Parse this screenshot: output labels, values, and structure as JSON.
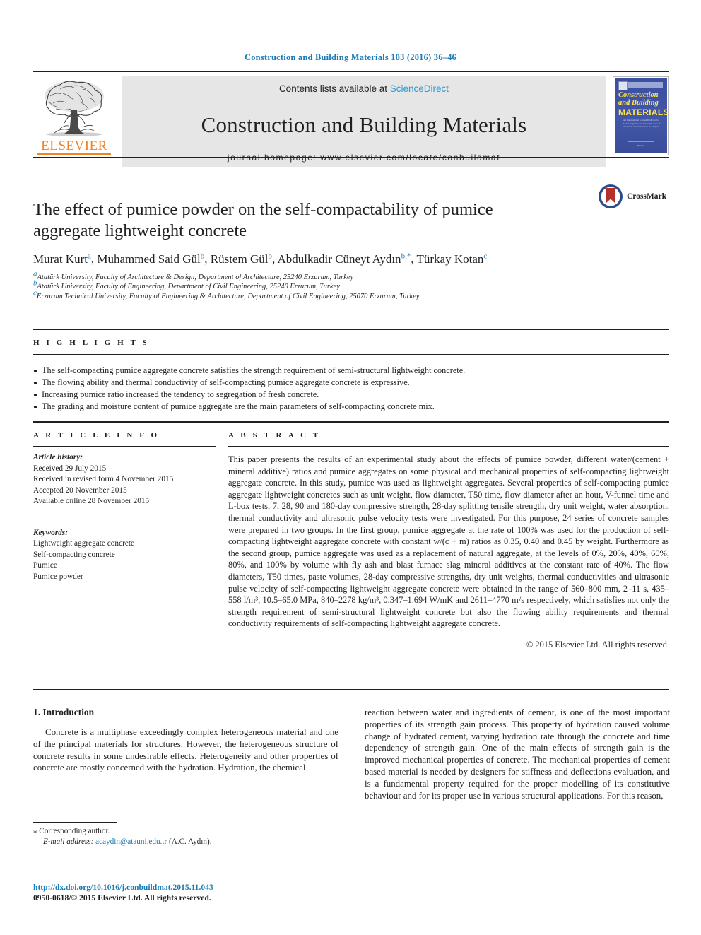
{
  "running_head": "Construction and Building Materials 103 (2016) 36–46",
  "masthead": {
    "publisher_name": "ELSEVIER",
    "contents_prefix": "Contents lists available at ",
    "contents_link": "ScienceDirect",
    "journal_name": "Construction and Building Materials",
    "homepage_line": "journal homepage: www.elsevier.com/locate/conbuildmat",
    "cover": {
      "line1": "Construction",
      "line2": "and Building",
      "line3": "MATERIALS",
      "blurb": "An International Journal Dedicated to the Investigation and Innovative Use of Materials in Construction and Repair",
      "footer": "Elsevier"
    }
  },
  "article": {
    "title": "The effect of pumice powder on the self-compactability of pumice aggregate lightweight concrete",
    "crossmark_label": "CrossMark",
    "authors": [
      {
        "name": "Murat Kurt",
        "sup": "a",
        "sep": ", "
      },
      {
        "name": "Muhammed Said Gül",
        "sup": "b",
        "sep": ", "
      },
      {
        "name": "Rüstem Gül",
        "sup": "b",
        "sep": ", "
      },
      {
        "name": "Abdulkadir Cüneyt Aydın",
        "sup": "b,*",
        "sep": ", "
      },
      {
        "name": "Türkay Kotan",
        "sup": "c",
        "sep": ""
      }
    ],
    "affiliations": [
      {
        "marker": "a",
        "text": "Atatürk University, Faculty of Architecture & Design, Department of Architecture, 25240 Erzurum, Turkey"
      },
      {
        "marker": "b",
        "text": "Atatürk University, Faculty of Engineering, Department of Civil Engineering, 25240 Erzurum, Turkey"
      },
      {
        "marker": "c",
        "text": "Erzurum Technical University, Faculty of Engineering & Architecture, Department of Civil Engineering, 25070 Erzurum, Turkey"
      }
    ]
  },
  "highlights": {
    "heading": "H I G H L I G H T S",
    "items": [
      "The self-compacting pumice aggregate concrete satisfies the strength requirement of semi-structural lightweight concrete.",
      "The flowing ability and thermal conductivity of self-compacting pumice aggregate concrete is expressive.",
      "Increasing pumice ratio increased the tendency to segregation of fresh concrete.",
      "The grading and moisture content of pumice aggregate are the main parameters of self-compacting concrete mix."
    ]
  },
  "article_info": {
    "heading": "A R T I C L E  I N F O",
    "history_label": "Article history:",
    "history": [
      "Received 29 July 2015",
      "Received in revised form 4 November 2015",
      "Accepted 20 November 2015",
      "Available online 28 November 2015"
    ],
    "keywords_label": "Keywords:",
    "keywords": [
      "Lightweight aggregate concrete",
      "Self-compacting concrete",
      "Pumice",
      "Pumice powder"
    ]
  },
  "abstract": {
    "heading": "A B S T R A C T",
    "text": "This paper presents the results of an experimental study about the effects of pumice powder, different water/(cement + mineral additive) ratios and pumice aggregates on some physical and mechanical properties of self-compacting lightweight aggregate concrete. In this study, pumice was used as lightweight aggregates. Several properties of self-compacting pumice aggregate lightweight concretes such as unit weight, flow diameter, T50 time, flow diameter after an hour, V-funnel time and L-box tests, 7, 28, 90 and 180-day compressive strength, 28-day splitting tensile strength, dry unit weight, water absorption, thermal conductivity and ultrasonic pulse velocity tests were investigated. For this purpose, 24 series of concrete samples were prepared in two groups. In the first group, pumice aggregate at the rate of 100% was used for the production of self-compacting lightweight aggregate concrete with constant w/(c + m) ratios as 0.35, 0.40 and 0.45 by weight. Furthermore as the second group, pumice aggregate was used as a replacement of natural aggregate, at the levels of 0%, 20%, 40%, 60%, 80%, and 100% by volume with fly ash and blast furnace slag mineral additives at the constant rate of 40%. The flow diameters, T50 times, paste volumes, 28-day compressive strengths, dry unit weights, thermal conductivities and ultrasonic pulse velocity of self-compacting lightweight aggregate concrete were obtained in the range of 560–800 mm, 2–11 s, 435–558 l/m³, 10.5–65.0 MPa, 840–2278 kg/m³, 0.347–1.694 W/mK and 2611–4770 m/s respectively, which satisfies not only the strength requirement of semi-structural lightweight concrete but also the flowing ability requirements and thermal conductivity requirements of self-compacting lightweight aggregate concrete.",
    "copyright": "© 2015 Elsevier Ltd. All rights reserved."
  },
  "body": {
    "section_title": "1. Introduction",
    "left_paragraph": "Concrete is a multiphase exceedingly complex heterogeneous material and one of the principal materials for structures. However, the heterogeneous structure of concrete results in some undesirable effects. Heterogeneity and other properties of concrete are mostly concerned with the hydration. Hydration, the chemical",
    "right_paragraph": "reaction between water and ingredients of cement, is one of the most important properties of its strength gain process. This property of hydration caused volume change of hydrated cement, varying hydration rate through the concrete and time dependency of strength gain. One of the main effects of strength gain is the improved mechanical properties of concrete. The mechanical properties of cement based material is needed by designers for stiffness and deflections evaluation, and is a fundamental property required for the proper modelling of its constitutive behaviour and for its proper use in various structural applications. For this reason,"
  },
  "footnote": {
    "corresponding_marker": "⁎",
    "corresponding_text": "Corresponding author.",
    "email_label": "E-mail address:",
    "email": "acaydin@atauni.edu.tr",
    "email_owner": "(A.C. Aydın)."
  },
  "footer": {
    "doi": "http://dx.doi.org/10.1016/j.conbuildmat.2015.11.043",
    "issn_line": "0950-0618/© 2015 Elsevier Ltd. All rights reserved."
  },
  "colors": {
    "link_blue": "#1a7bb5",
    "sciencedirect_blue": "#2e9bd6",
    "elsevier_orange": "#F58220",
    "crossmark_red": "#b4322a",
    "crossmark_blue": "#2b4b8c",
    "cover_blue": "#3b4fa0",
    "cover_yellow": "#ffe24d"
  }
}
